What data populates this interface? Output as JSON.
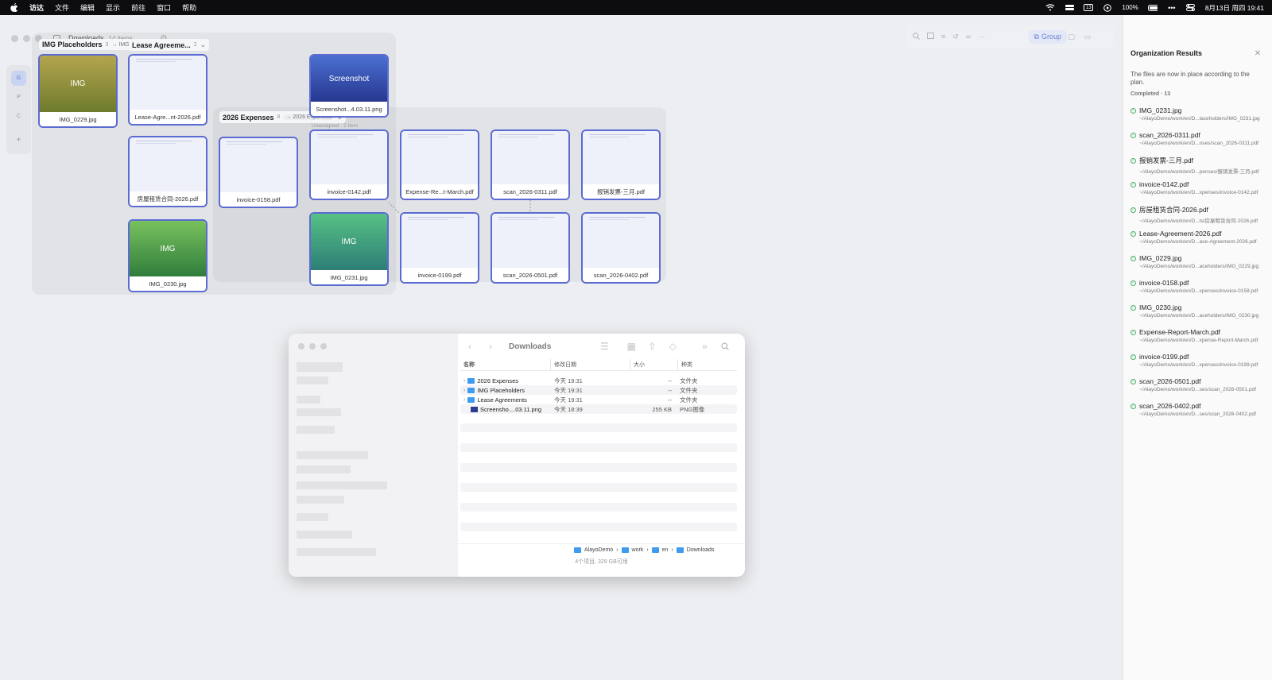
{
  "menubar": {
    "apple_icon": "apple-icon",
    "items": [
      "访达",
      "文件",
      "编辑",
      "显示",
      "前往",
      "窗口",
      "帮助"
    ],
    "status": {
      "calendar_badge": "13",
      "battery": "100%",
      "datetime": "8月13日 周四 19:41"
    }
  },
  "canvas": {
    "window_title": "Downloads",
    "item_count": "14 items",
    "rail": [
      "G",
      "P",
      "C",
      "+"
    ],
    "group_button": "Group",
    "groups": {
      "img": {
        "name": "IMG Placeholders",
        "count": "3",
        "target": "→ IMG"
      },
      "lease": {
        "name": "Lease Agreeme...",
        "count": "2"
      },
      "expenses": {
        "name": "2026 Expenses",
        "count": "8",
        "target": "→ 2026 Expenses",
        "sub": "Unassigned · 2 Item"
      }
    },
    "cards": {
      "img0229": {
        "thumb": "IMG",
        "name": "IMG_0229.jpg"
      },
      "lease_en": {
        "name": "Lease-Agre...nt-2026.pdf"
      },
      "lease_cn": {
        "name": "房屋租赁合同-2026.pdf"
      },
      "img0230": {
        "thumb": "IMG",
        "name": "IMG_0230.jpg"
      },
      "screenshot": {
        "thumb": "Screenshot",
        "name": "Screenshot...4.03.11.png"
      },
      "inv0158": {
        "name": "invoice-0158.pdf"
      },
      "inv0142": {
        "name": "invoice-0142.pdf"
      },
      "expense": {
        "name": "Expense-Re...t-March.pdf"
      },
      "scan0311": {
        "name": "scan_2026-0311.pdf"
      },
      "baoxiao": {
        "name": "报销发票-三月.pdf"
      },
      "img0231": {
        "thumb": "IMG",
        "name": "IMG_0231.jpg"
      },
      "inv0199": {
        "name": "invoice-0199.pdf"
      },
      "scan0501": {
        "name": "scan_2026-0501.pdf"
      },
      "scan0402": {
        "name": "scan_2026-0402.pdf"
      }
    }
  },
  "finder": {
    "title": "Downloads",
    "columns": [
      "名称",
      "修改日期",
      "大小",
      "种类"
    ],
    "rows": [
      {
        "name": "2026 Expenses",
        "date": "今天 19:31",
        "size": "--",
        "kind": "文件夹"
      },
      {
        "name": "IMG Placeholders",
        "date": "今天 19:31",
        "size": "--",
        "kind": "文件夹"
      },
      {
        "name": "Lease Agreements",
        "date": "今天 19:31",
        "size": "--",
        "kind": "文件夹"
      },
      {
        "name": "Screensho....03.11.png",
        "date": "今天 18:39",
        "size": "255 KB",
        "kind": "PNG图像"
      }
    ],
    "path": [
      "AlayoDemo",
      "work",
      "en",
      "Downloads"
    ],
    "status": "4个项目, 329 GB可用"
  },
  "panel": {
    "title": "Organization Results",
    "message": "The files are now in place according to the plan.",
    "completed": "Completed · 13",
    "items": [
      {
        "name": "IMG_0231.jpg",
        "path": "~/AlayoDemo/work/en/D...laceholders/IMG_0231.jpg"
      },
      {
        "name": "scan_2026-0311.pdf",
        "path": "~/AlayoDemo/work/en/D...nses/scan_2026-0311.pdf"
      },
      {
        "name": "报销发票-三月.pdf",
        "path": "~/AlayoDemo/work/en/D...penses/报销发票-三月.pdf"
      },
      {
        "name": "invoice-0142.pdf",
        "path": "~/AlayoDemo/work/en/D...xpenses/invoice-0142.pdf"
      },
      {
        "name": "房屋租赁合同-2026.pdf",
        "path": "~/AlayoDemo/work/en/D...ts/房屋租赁合同-2026.pdf"
      },
      {
        "name": "Lease-Agreement-2026.pdf",
        "path": "~/AlayoDemo/work/en/D...ase-Agreement-2026.pdf"
      },
      {
        "name": "IMG_0229.jpg",
        "path": "~/AlayoDemo/work/en/D...aceholders/IMG_0229.jpg"
      },
      {
        "name": "invoice-0158.pdf",
        "path": "~/AlayoDemo/work/en/D...xpenses/invoice-0158.pdf"
      },
      {
        "name": "IMG_0230.jpg",
        "path": "~/AlayoDemo/work/en/D...aceholders/IMG_0230.jpg"
      },
      {
        "name": "Expense-Report-March.pdf",
        "path": "~/AlayoDemo/work/en/D...xpense-Report-March.pdf"
      },
      {
        "name": "invoice-0199.pdf",
        "path": "~/AlayoDemo/work/en/D...xpenses/invoice-0199.pdf"
      },
      {
        "name": "scan_2026-0501.pdf",
        "path": "~/AlayoDemo/work/en/D...ses/scan_2026-0501.pdf"
      },
      {
        "name": "scan_2026-0402.pdf",
        "path": "~/AlayoDemo/work/en/D...ses/scan_2026-0402.pdf"
      }
    ]
  }
}
